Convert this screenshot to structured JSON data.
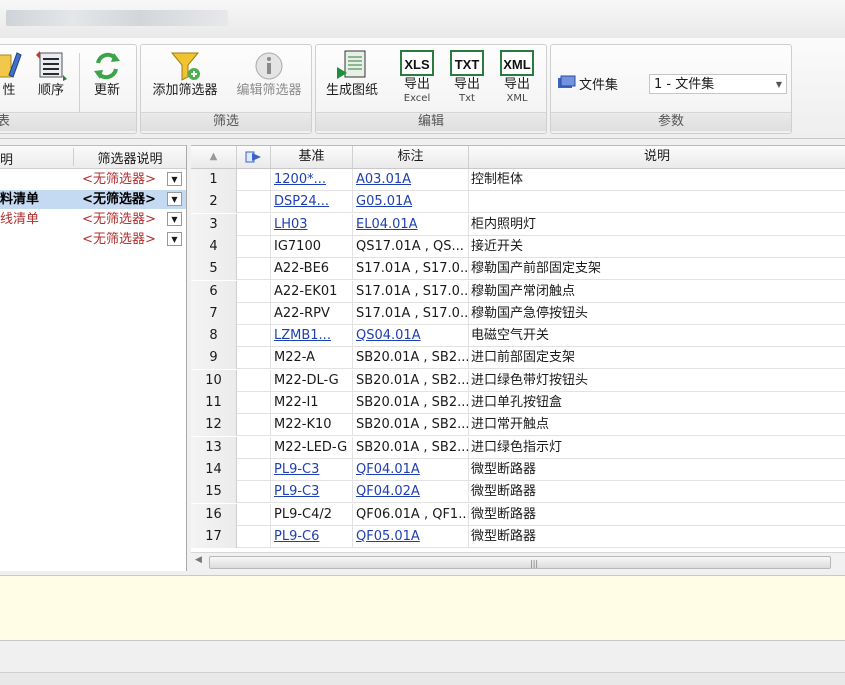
{
  "ribbon": {
    "group1": {
      "buttons": [
        {
          "label": "性"
        },
        {
          "label": "顺序"
        },
        {
          "label": "更新"
        }
      ],
      "caption": "表"
    },
    "group2": {
      "buttons": [
        {
          "label": "添加筛选器"
        },
        {
          "label": "编辑筛选器"
        }
      ],
      "caption": "筛选"
    },
    "group3": {
      "buttons": [
        {
          "label": "生成图纸"
        },
        {
          "label": "导出",
          "sub": "Excel",
          "icon_text": "XLS"
        },
        {
          "label": "导出",
          "sub": "Txt",
          "icon_text": "TXT"
        },
        {
          "label": "导出",
          "sub": "XML",
          "icon_text": "XML"
        }
      ],
      "caption": "编辑"
    },
    "group4": {
      "label": "文件集",
      "combo_value": "1 - 文件集",
      "caption": "参数"
    }
  },
  "left_pane": {
    "headers": [
      "明",
      "筛选器说明"
    ],
    "rows": [
      {
        "name": "",
        "filter": "<无筛选器>",
        "selected": false
      },
      {
        "name": "料清单",
        "filter": "<无筛选器>",
        "selected": true
      },
      {
        "name": "线清单",
        "filter": "<无筛选器>",
        "selected": false
      },
      {
        "name": "",
        "filter": "<无筛选器>",
        "selected": false
      }
    ]
  },
  "grid": {
    "headers": {
      "sort": "▲",
      "base": "基准",
      "mark": "标注",
      "desc": "说明"
    },
    "rows": [
      {
        "num": "1",
        "base": "1200*...",
        "mark": "A03.01A",
        "desc": "控制柜体",
        "link": true
      },
      {
        "num": "2",
        "base": "DSP24...",
        "mark": "G05.01A",
        "desc": "",
        "link": true
      },
      {
        "num": "3",
        "base": "LH03",
        "mark": "EL04.01A",
        "desc": "柜内照明灯",
        "link": true
      },
      {
        "num": "4",
        "base": "IG7100",
        "mark": "QS17.01A , QS...",
        "desc": "接近开关",
        "link": false
      },
      {
        "num": "5",
        "base": "A22-BE6",
        "mark": "S17.01A , S17.0...",
        "desc": "穆勒国产前部固定支架",
        "link": false
      },
      {
        "num": "6",
        "base": "A22-EK01",
        "mark": "S17.01A , S17.0...",
        "desc": "穆勒国产常闭触点",
        "link": false
      },
      {
        "num": "7",
        "base": "A22-RPV",
        "mark": "S17.01A , S17.0...",
        "desc": "穆勒国产急停按钮头",
        "link": false
      },
      {
        "num": "8",
        "base": "LZMB1...",
        "mark": "QS04.01A",
        "desc": "电磁空气开关",
        "link": true
      },
      {
        "num": "9",
        "base": "M22-A",
        "mark": "SB20.01A , SB2...",
        "desc": "进口前部固定支架",
        "link": false
      },
      {
        "num": "10",
        "base": "M22-DL-G",
        "mark": "SB20.01A , SB2...",
        "desc": "进口绿色带灯按钮头",
        "link": false
      },
      {
        "num": "11",
        "base": "M22-I1",
        "mark": "SB20.01A , SB2...",
        "desc": "进口单孔按钮盒",
        "link": false
      },
      {
        "num": "12",
        "base": "M22-K10",
        "mark": "SB20.01A , SB2...",
        "desc": "进口常开触点",
        "link": false
      },
      {
        "num": "13",
        "base": "M22-LED-G",
        "mark": "SB20.01A , SB2...",
        "desc": "进口绿色指示灯",
        "link": false
      },
      {
        "num": "14",
        "base": "PL9-C3",
        "mark": "QF04.01A",
        "desc": "微型断路器",
        "link": true
      },
      {
        "num": "15",
        "base": "PL9-C3",
        "mark": "QF04.02A",
        "desc": "微型断路器",
        "link": true
      },
      {
        "num": "16",
        "base": "PL9-C4/2",
        "mark": "QF06.01A , QF1...",
        "desc": "微型断路器",
        "link": false
      },
      {
        "num": "17",
        "base": "PL9-C6",
        "mark": "QF05.01A",
        "desc": "微型断路器",
        "link": true
      }
    ]
  },
  "colors": {
    "link": "#1f3fb4",
    "selection": "#c4d9f2",
    "notes_bg": "#fffde6",
    "filter_text": "#b03030"
  }
}
